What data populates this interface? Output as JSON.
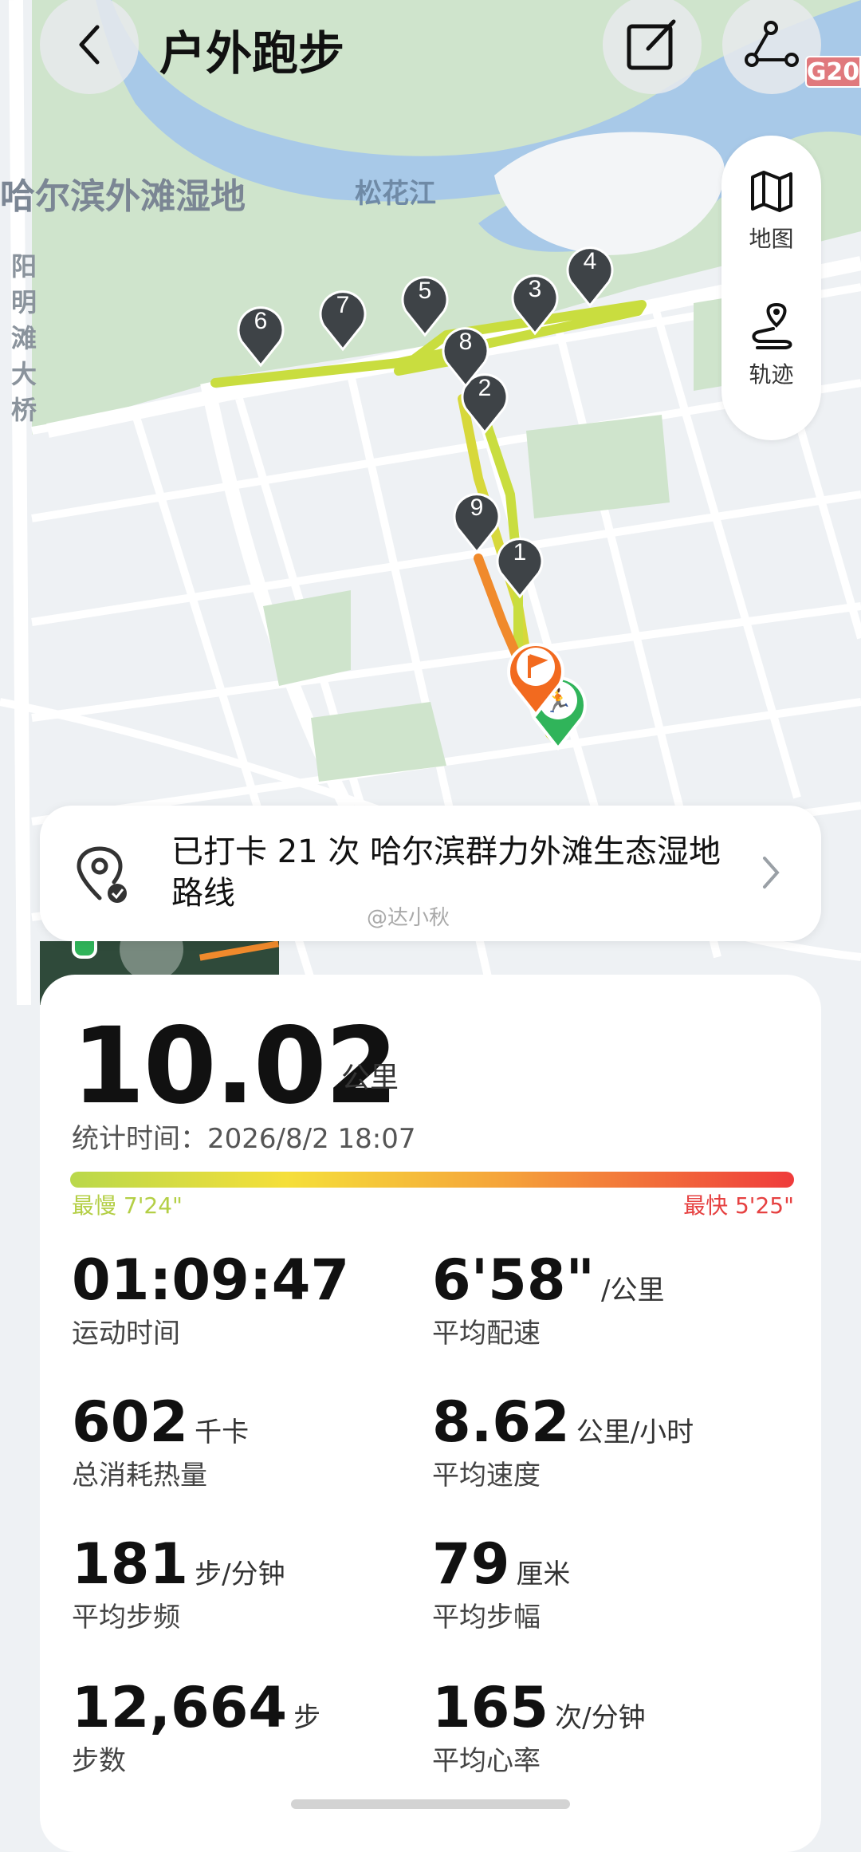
{
  "header": {
    "title": "户外跑步",
    "back_icon": "chevron-left-icon",
    "edit_icon": "edit-icon",
    "share_icon": "share-route-icon"
  },
  "map": {
    "road_badge": "G20",
    "labels": {
      "wetland": "哈尔滨外滩湿地",
      "river": "松花江",
      "bridge": "阳明滩大桥"
    },
    "markers": [
      "1",
      "2",
      "3",
      "4",
      "5",
      "6",
      "7",
      "8",
      "9"
    ],
    "colors": {
      "route_slow": "#c9dd3f",
      "route_fast": "#f08a2c",
      "start": "#30b45a",
      "finish": "#f26a1f",
      "river": "#a8c9e8",
      "park": "#cfe4cc"
    }
  },
  "side_panel": {
    "map_label": "地图",
    "track_label": "轨迹"
  },
  "route_card": {
    "text": "已打卡 21 次 哈尔滨群力外滩生态湿地路线",
    "watermark": "@达小秋"
  },
  "summary": {
    "distance": "10.02",
    "distance_unit": "公里",
    "time_label": "统计时间：2026/8/2 18:07",
    "slowest": "最慢 7'24\"",
    "fastest": "最快 5'25\""
  },
  "metrics": [
    {
      "value": "01:09:47",
      "unit": "",
      "label": "运动时间"
    },
    {
      "value": "6'58\"",
      "unit": "/公里",
      "label": "平均配速"
    },
    {
      "value": "602",
      "unit": "千卡",
      "label": "总消耗热量"
    },
    {
      "value": "8.62",
      "unit": "公里/小时",
      "label": "平均速度"
    },
    {
      "value": "181",
      "unit": "步/分钟",
      "label": "平均步频"
    },
    {
      "value": "79",
      "unit": "厘米",
      "label": "平均步幅"
    },
    {
      "value": "12,664",
      "unit": "步",
      "label": "步数"
    },
    {
      "value": "165",
      "unit": "次/分钟",
      "label": "平均心率"
    }
  ]
}
